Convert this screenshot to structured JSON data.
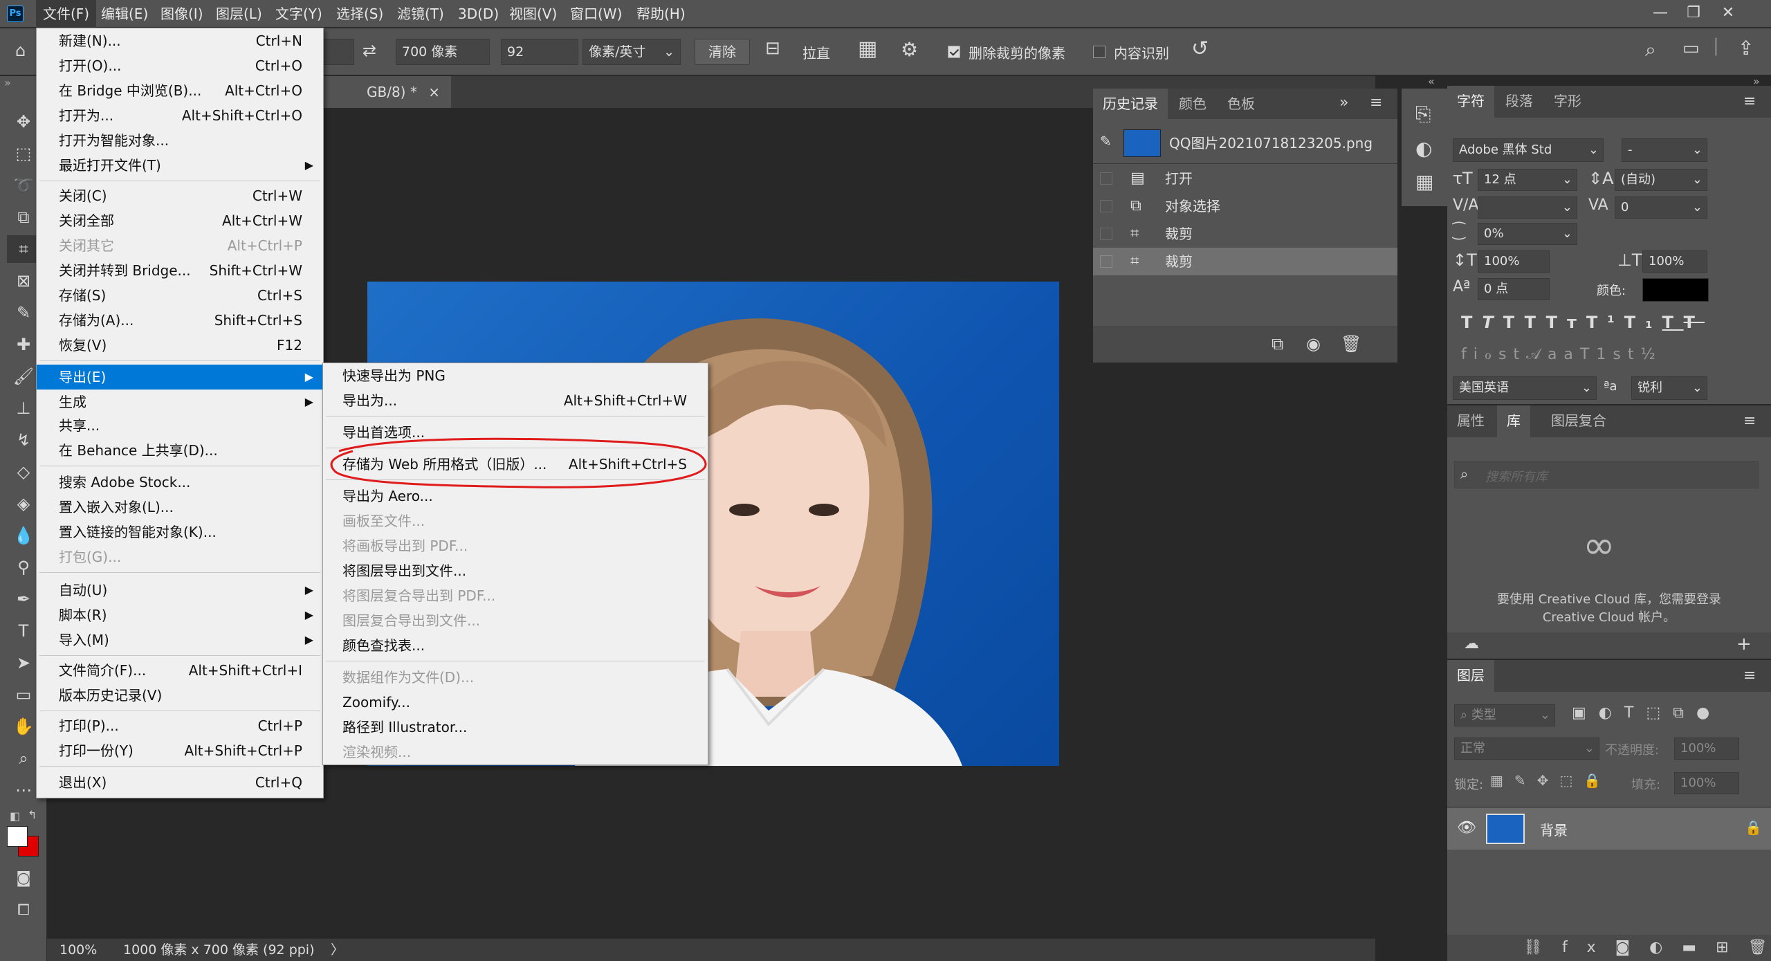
{
  "app": {
    "logo": "Ps"
  },
  "menubar": {
    "items": [
      "文件(F)",
      "编辑(E)",
      "图像(I)",
      "图层(L)",
      "文字(Y)",
      "选择(S)",
      "滤镜(T)",
      "3D(D)",
      "视图(V)",
      "窗口(W)",
      "帮助(H)"
    ],
    "window_controls": {
      "minimize": "—",
      "restore": "❐",
      "close": "✕"
    }
  },
  "options": {
    "height_value": "700 像素",
    "resolution_value": "92",
    "resolution_unit": "像素/英寸",
    "clear_label": "清除",
    "straighten_label": "拉直",
    "delete_cropped_label": "删除裁剪的像素",
    "delete_cropped_checked": true,
    "content_aware_label": "内容识别",
    "content_aware_checked": false
  },
  "document": {
    "tab_title": "GB/8) *",
    "tab_close": "×",
    "zoom": "100%",
    "info": "1000 像素 x 700 像素 (92 ppi)",
    "info_arrow": "〉"
  },
  "file_menu": {
    "items": [
      {
        "label": "新建(N)...",
        "shortcut": "Ctrl+N"
      },
      {
        "label": "打开(O)...",
        "shortcut": "Ctrl+O"
      },
      {
        "label": "在 Bridge 中浏览(B)...",
        "shortcut": "Alt+Ctrl+O"
      },
      {
        "label": "打开为...",
        "shortcut": "Alt+Shift+Ctrl+O"
      },
      {
        "label": "打开为智能对象...",
        "shortcut": ""
      },
      {
        "label": "最近打开文件(T)",
        "shortcut": ""
      },
      {
        "label": "关闭(C)",
        "shortcut": "Ctrl+W"
      },
      {
        "label": "关闭全部",
        "shortcut": "Alt+Ctrl+W"
      },
      {
        "label": "关闭其它",
        "shortcut": "Alt+Ctrl+P"
      },
      {
        "label": "关闭并转到 Bridge...",
        "shortcut": "Shift+Ctrl+W"
      },
      {
        "label": "存储(S)",
        "shortcut": "Ctrl+S"
      },
      {
        "label": "存储为(A)...",
        "shortcut": "Shift+Ctrl+S"
      },
      {
        "label": "恢复(V)",
        "shortcut": "F12"
      },
      {
        "label": "导出(E)",
        "shortcut": ""
      },
      {
        "label": "生成",
        "shortcut": ""
      },
      {
        "label": "共享...",
        "shortcut": ""
      },
      {
        "label": "在 Behance 上共享(D)...",
        "shortcut": ""
      },
      {
        "label": "搜索 Adobe Stock...",
        "shortcut": ""
      },
      {
        "label": "置入嵌入对象(L)...",
        "shortcut": ""
      },
      {
        "label": "置入链接的智能对象(K)...",
        "shortcut": ""
      },
      {
        "label": "打包(G)...",
        "shortcut": ""
      },
      {
        "label": "自动(U)",
        "shortcut": ""
      },
      {
        "label": "脚本(R)",
        "shortcut": ""
      },
      {
        "label": "导入(M)",
        "shortcut": ""
      },
      {
        "label": "文件简介(F)...",
        "shortcut": "Alt+Shift+Ctrl+I"
      },
      {
        "label": "版本历史记录(V)",
        "shortcut": ""
      },
      {
        "label": "打印(P)...",
        "shortcut": "Ctrl+P"
      },
      {
        "label": "打印一份(Y)",
        "shortcut": "Alt+Shift+Ctrl+P"
      },
      {
        "label": "退出(X)",
        "shortcut": "Ctrl+Q"
      }
    ]
  },
  "export_menu": {
    "items": [
      {
        "label": "快速导出为 PNG",
        "shortcut": ""
      },
      {
        "label": "导出为...",
        "shortcut": "Alt+Shift+Ctrl+W"
      },
      {
        "label": "导出首选项...",
        "shortcut": ""
      },
      {
        "label": "存储为 Web 所用格式（旧版）...",
        "shortcut": "Alt+Shift+Ctrl+S"
      },
      {
        "label": "导出为 Aero...",
        "shortcut": ""
      },
      {
        "label": "画板至文件...",
        "shortcut": ""
      },
      {
        "label": "将画板导出到 PDF...",
        "shortcut": ""
      },
      {
        "label": "将图层导出到文件...",
        "shortcut": ""
      },
      {
        "label": "将图层复合导出到 PDF...",
        "shortcut": ""
      },
      {
        "label": "图层复合导出到文件...",
        "shortcut": ""
      },
      {
        "label": "颜色查找表...",
        "shortcut": ""
      },
      {
        "label": "数据组作为文件(D)...",
        "shortcut": ""
      },
      {
        "label": "Zoomify...",
        "shortcut": ""
      },
      {
        "label": "路径到 Illustrator...",
        "shortcut": ""
      },
      {
        "label": "渲染视频...",
        "shortcut": ""
      }
    ]
  },
  "history_panel": {
    "tabs": [
      "历史记录",
      "颜色",
      "色板"
    ],
    "snapshot": "QQ图片20210718123205.png",
    "steps": [
      "打开",
      "对象选择",
      "裁剪",
      "裁剪"
    ]
  },
  "character_panel": {
    "tabs": [
      "字符",
      "段落",
      "字形"
    ],
    "font_family": "Adobe 黑体 Std",
    "font_style": "-",
    "font_size": "12 点",
    "leading": "(自动)",
    "kerning": "",
    "tracking": "0",
    "tsume": "0%",
    "vscale": "100%",
    "hscale": "100%",
    "baseline": "0 点",
    "color_label": "颜色:",
    "color_value": "#000000",
    "language": "美国英语",
    "aa_label": "ªa",
    "antialias": "锐利"
  },
  "library_panel": {
    "tabs": [
      "属性",
      "库",
      "图层复合"
    ],
    "search_placeholder": "搜索所有库",
    "message_line1": "要使用 Creative Cloud 库，您需要登录",
    "message_line2": "Creative Cloud 帐户。"
  },
  "layers_panel": {
    "title": "图层",
    "filter_type": "类型",
    "blend_mode": "正常",
    "opacity_label": "不透明度:",
    "opacity_value": "100%",
    "lock_label": "锁定:",
    "fill_label": "填充:",
    "fill_value": "100%",
    "layer_name": "背景"
  }
}
